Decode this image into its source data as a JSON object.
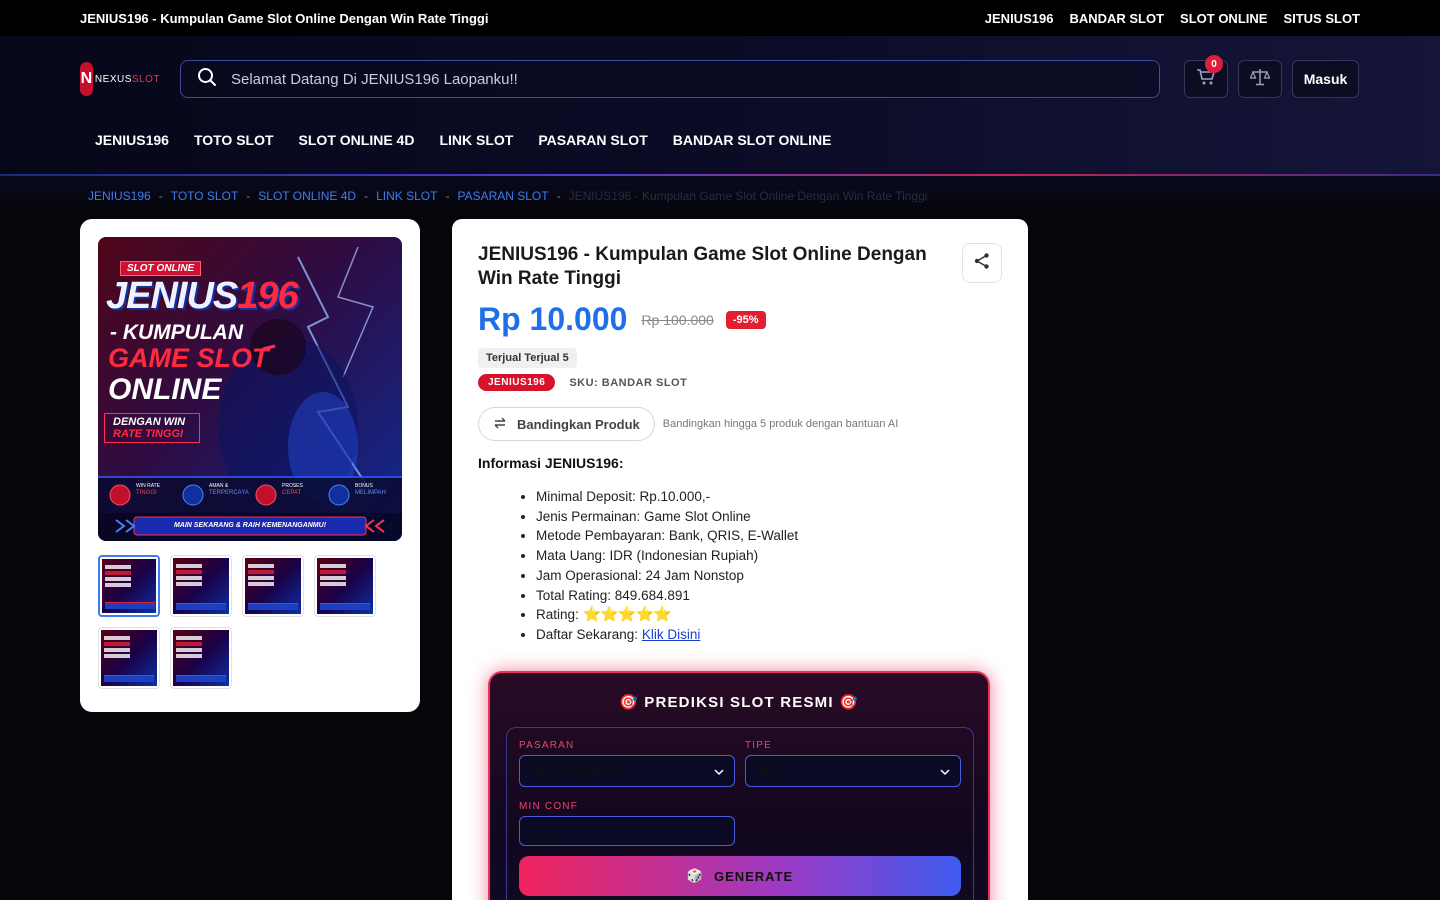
{
  "topbar": {
    "title": "JENIUS196 - Kumpulan Game Slot Online Dengan Win Rate Tinggi",
    "links": [
      "JENIUS196",
      "BANDAR SLOT",
      "SLOT ONLINE",
      "SITUS SLOT"
    ]
  },
  "header": {
    "logo_letter": "N",
    "logo_text_a": "NEXUS",
    "logo_text_b": "SLOT",
    "search_placeholder": "Selamat Datang Di JENIUS196 Laopanku!!",
    "cart_count": "0",
    "login_label": "Masuk"
  },
  "nav": {
    "items": [
      "JENIUS196",
      "TOTO SLOT",
      "SLOT ONLINE 4D",
      "LINK SLOT",
      "PASARAN SLOT",
      "BANDAR SLOT ONLINE"
    ]
  },
  "breadcrumb": {
    "items": [
      "JENIUS196",
      "TOTO SLOT",
      "SLOT ONLINE 4D",
      "LINK SLOT",
      "PASARAN SLOT"
    ],
    "separator": "-",
    "current": "JENIUS196 - Kumpulan Game Slot Online Dengan Win Rate Tinggi"
  },
  "product": {
    "title": "JENIUS196 - Kumpulan Game Slot Online Dengan Win Rate Tinggi",
    "price": "Rp 10.000",
    "old_price": "Rp 100.000",
    "discount": "-95%",
    "sold": "Terjual Terjual 5",
    "tag": "JENIUS196",
    "sku": "SKU: BANDAR SLOT",
    "compare_label": "Bandingkan Produk",
    "compare_note": "Bandingkan hingga 5 produk dengan bantuan AI",
    "info_heading": "Informasi JENIUS196:",
    "info_items": [
      "Minimal Deposit: Rp.10.000,-",
      "Jenis Permainan: Game Slot Online",
      "Metode Pembayaran: Bank, QRIS, E-Wallet",
      "Mata Uang: IDR (Indonesian Rupiah)",
      "Jam Operasional: 24 Jam Nonstop",
      "Total Rating: 849.684.891"
    ],
    "rating_label": "Rating:",
    "rating_stars": "⭐⭐⭐⭐⭐",
    "daftar_label": "Daftar Sekarang:",
    "daftar_link": "Klik Disini"
  },
  "image_text": {
    "badge": "SLOT ONLINE",
    "brand_a": "JENIUS",
    "brand_b": "196",
    "line1": "- KUMPULAN",
    "line2": "GAME SLOT",
    "line3": "ONLINE",
    "line4": "DENGAN WIN",
    "line5": "RATE TINGGI",
    "f1a": "WIN RATE",
    "f1b": "TINGGI",
    "f2a": "AMAN &",
    "f2b": "TERPERCAYA",
    "f3a": "PROSES",
    "f3b": "CEPAT",
    "f4a": "BONUS",
    "f4b": "MELIMPAH",
    "cta": "MAIN SEKARANG & RAIH KEMENANGANMU!"
  },
  "prediksi": {
    "title": "🎯 PREDIKSI SLOT RESMI 🎯",
    "pasaran_label": "PASARAN",
    "pasaran_value": "ALL PASARAN",
    "tipe_label": "TIPE",
    "tipe_value": "4D",
    "minconf_label": "MIN CONF",
    "minconf_value": "70",
    "generate_label": "GENERATE",
    "generate_icon": "🎲"
  },
  "colors": {
    "accent_blue": "#1e6fe8",
    "accent_red": "#e0202e",
    "link_blue": "#3e7cf0"
  }
}
